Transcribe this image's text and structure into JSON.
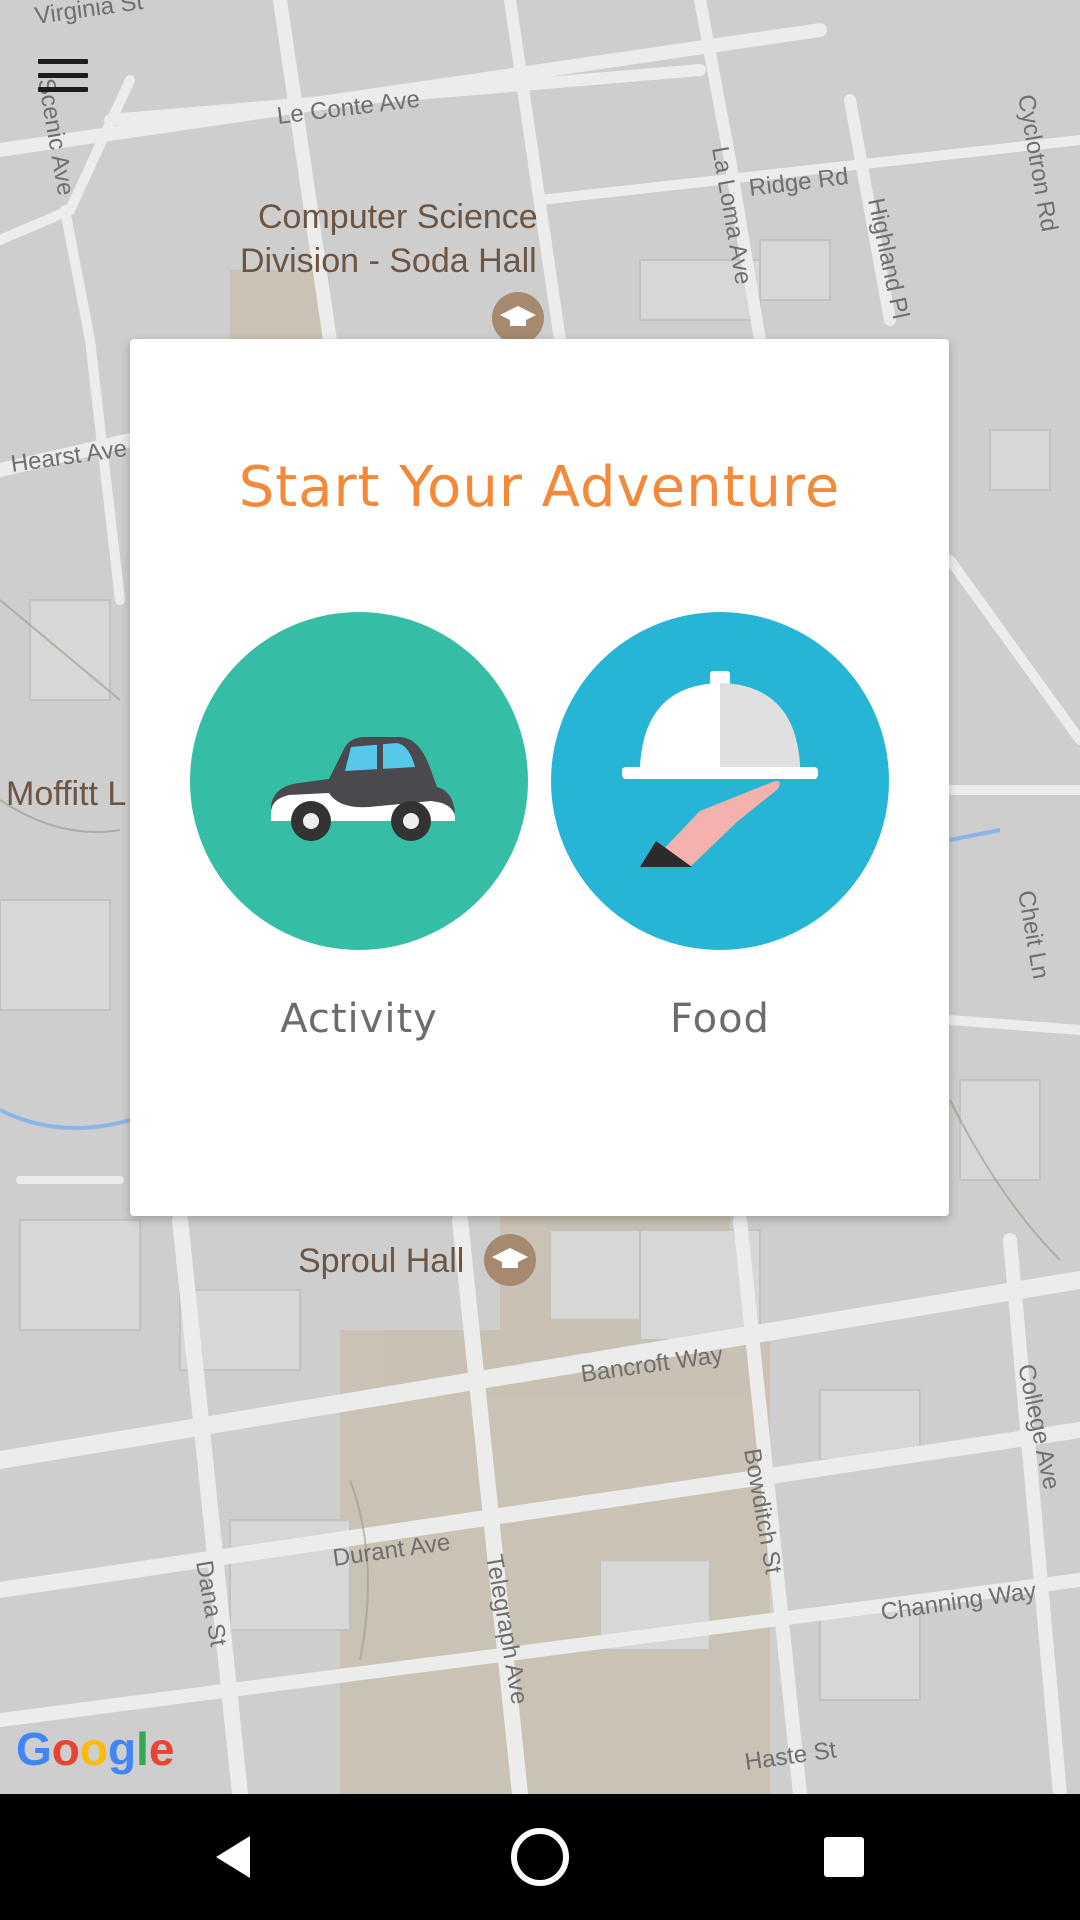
{
  "map": {
    "streets": [
      "Virginia St",
      "Le Conte Ave",
      "Scenic Ave",
      "Ridge Rd",
      "La Loma Ave",
      "Highland Pl",
      "Cyclotron Rd",
      "Hearst Ave",
      "Cheit Ln",
      "Bancroft Way",
      "College Ave",
      "Bowditch St",
      "Durant Ave",
      "Dana St",
      "Telegraph Ave",
      "Channing Way",
      "Haste St"
    ],
    "places": {
      "soda_line1": "Computer Science",
      "soda_line2": "Division - Soda Hall",
      "moffitt": "Moffitt L",
      "sproul": "Sproul Hall"
    },
    "poi_icon": "graduation-cap-icon",
    "colors": {
      "background": "#cfcfcf",
      "road": "#e9e9e9",
      "campus": "#c8bba7",
      "water": "#8ab5e8"
    }
  },
  "menu": {
    "icon": "hamburger-menu-icon"
  },
  "dialog": {
    "title": "Start Your Adventure",
    "title_color": "#f5893a",
    "options": [
      {
        "label": "Activity",
        "icon": "car-icon",
        "color": "#35bea5"
      },
      {
        "label": "Food",
        "icon": "serving-cloche-icon",
        "color": "#27b5d6"
      }
    ]
  },
  "google_logo": {
    "letters": [
      "G",
      "o",
      "o",
      "g",
      "l",
      "e"
    ],
    "colors": [
      "#4285f4",
      "#ea4335",
      "#fbbc05",
      "#4285f4",
      "#34a853",
      "#ea4335"
    ]
  },
  "nav_bar": {
    "buttons": [
      "back-icon",
      "home-icon",
      "recents-icon"
    ]
  }
}
